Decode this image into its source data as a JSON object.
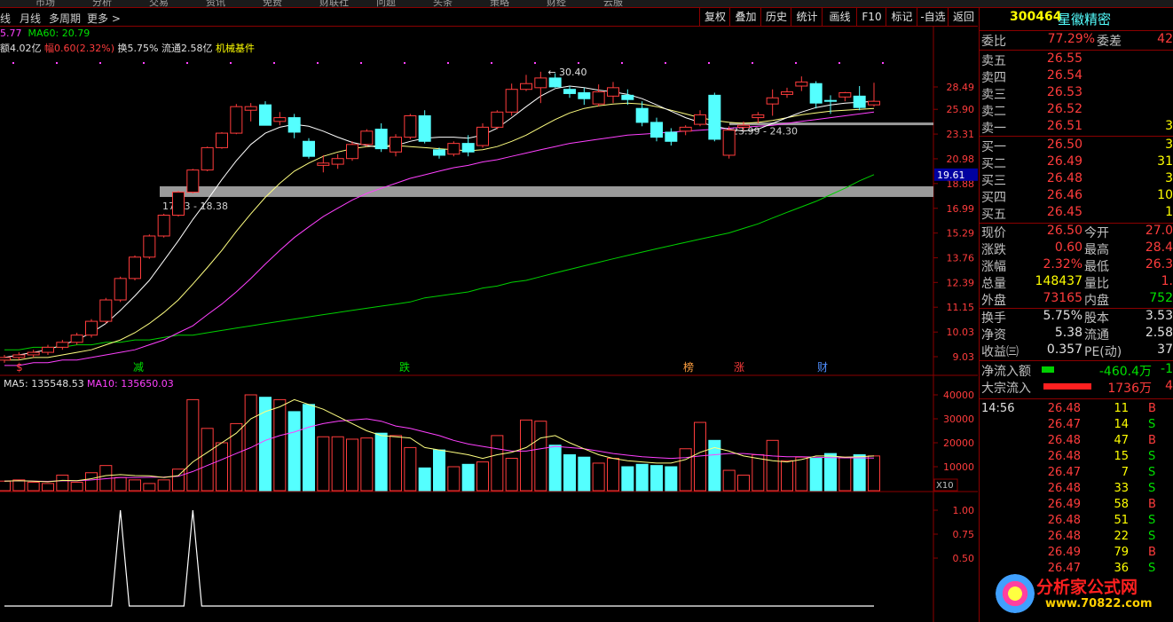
{
  "top_menu": [
    "市场",
    "分析",
    "交易",
    "资讯",
    "免费",
    "财联社",
    "问题",
    "头条",
    "策略",
    "财经",
    "云服"
  ],
  "menubar": {
    "left_items": [
      "线",
      "月线",
      "多周期",
      "更多 >"
    ],
    "buttons": [
      "复权",
      "叠加",
      "历史",
      "统计",
      "画线",
      "F10",
      "标记",
      "-自选",
      "返回"
    ]
  },
  "info_line1": {
    "ma_a": "5.77",
    "ma60_label": "MA60: 20.79"
  },
  "info_line2": {
    "amount": "额4.02亿",
    "change": "幅0.60(2.32%)",
    "turnover": "换5.75%",
    "float": "流通2.58亿",
    "sector": "机械基件"
  },
  "main_chart": {
    "price_axis": [
      "28.49",
      "25.90",
      "23.31",
      "20.98",
      "18.88",
      "16.99",
      "15.29",
      "13.76",
      "12.39",
      "11.15",
      "10.03",
      "9.03"
    ],
    "current_price_tag": "19.61",
    "annotations": {
      "high": "30.40",
      "zone_upper": "23.99 - 24.30",
      "zone_lower": "17.53 - 18.38"
    },
    "events": [
      {
        "label": "$",
        "color": "#ff3c3c"
      },
      {
        "label": "减",
        "color": "#00e000"
      },
      {
        "label": "跌",
        "color": "#00e000"
      },
      {
        "label": "榜",
        "color": "#ffa040"
      },
      {
        "label": "涨",
        "color": "#ff3c3c"
      },
      {
        "label": "财",
        "color": "#4f8fff"
      }
    ]
  },
  "volume_chart": {
    "ma5_label": "MA5: 135548.53",
    "ma10_label": "MA10: 135650.03",
    "axis": [
      "40000",
      "30000",
      "20000",
      "10000"
    ],
    "unit": "X10"
  },
  "indicator_chart": {
    "axis": [
      "1.00",
      "0.75",
      "0.50"
    ]
  },
  "chart_data": [
    {
      "type": "candlestick",
      "candles": [
        [
          8.9,
          9.1,
          8.8,
          9.0
        ],
        [
          9.0,
          9.2,
          8.9,
          9.1
        ],
        [
          9.1,
          9.3,
          9.0,
          9.2
        ],
        [
          9.2,
          9.5,
          9.1,
          9.4
        ],
        [
          9.4,
          9.7,
          9.3,
          9.6
        ],
        [
          9.6,
          10.0,
          9.5,
          9.9
        ],
        [
          9.9,
          10.6,
          9.8,
          10.5
        ],
        [
          10.5,
          11.6,
          10.4,
          11.5
        ],
        [
          11.5,
          12.7,
          11.4,
          12.6
        ],
        [
          12.6,
          13.9,
          12.5,
          13.8
        ],
        [
          13.8,
          15.2,
          13.7,
          15.1
        ],
        [
          15.1,
          16.6,
          15.0,
          16.5
        ],
        [
          16.5,
          18.3,
          16.4,
          18.2
        ],
        [
          18.2,
          20.1,
          18.1,
          20.0
        ],
        [
          20.0,
          22.1,
          19.9,
          22.0
        ],
        [
          22.0,
          23.5,
          21.9,
          23.4
        ],
        [
          23.4,
          26.5,
          23.3,
          26.2
        ],
        [
          25.8,
          26.6,
          24.6,
          26.2
        ],
        [
          26.4,
          26.8,
          25.1,
          24.2
        ],
        [
          24.6,
          25.6,
          24.2,
          25.0
        ],
        [
          25.0,
          25.4,
          22.9,
          23.5
        ],
        [
          22.6,
          22.9,
          21.0,
          21.2
        ],
        [
          20.4,
          21.3,
          19.8,
          20.6
        ],
        [
          20.5,
          21.4,
          20.1,
          21.0
        ],
        [
          21.0,
          22.6,
          20.8,
          22.3
        ],
        [
          22.3,
          23.8,
          22.1,
          23.6
        ],
        [
          23.8,
          24.4,
          21.6,
          21.9
        ],
        [
          21.6,
          23.3,
          21.2,
          23.0
        ],
        [
          23.0,
          25.4,
          22.8,
          25.2
        ],
        [
          25.2,
          25.8,
          22.4,
          22.6
        ],
        [
          21.8,
          22.0,
          21.0,
          21.3
        ],
        [
          21.4,
          22.6,
          21.2,
          22.4
        ],
        [
          22.4,
          23.2,
          21.2,
          21.6
        ],
        [
          22.2,
          24.4,
          22.0,
          24.0
        ],
        [
          24.0,
          25.8,
          23.8,
          25.6
        ],
        [
          25.6,
          28.9,
          25.2,
          28.2
        ],
        [
          28.2,
          30.0,
          28.0,
          28.9
        ],
        [
          28.4,
          30.4,
          26.6,
          29.6
        ],
        [
          29.6,
          30.2,
          28.4,
          28.5
        ],
        [
          28.2,
          28.6,
          27.2,
          27.7
        ],
        [
          27.8,
          28.4,
          26.4,
          27.1
        ],
        [
          26.5,
          28.8,
          26.2,
          27.9
        ],
        [
          27.4,
          29.1,
          26.6,
          28.4
        ],
        [
          27.5,
          28.2,
          26.4,
          27.0
        ],
        [
          26.0,
          26.8,
          24.1,
          24.5
        ],
        [
          24.5,
          25.0,
          22.6,
          23.0
        ],
        [
          23.5,
          23.9,
          22.2,
          22.6
        ],
        [
          23.6,
          24.2,
          23.2,
          24.0
        ],
        [
          24.3,
          25.8,
          24.1,
          25.3
        ],
        [
          27.5,
          27.8,
          22.6,
          22.8
        ],
        [
          21.3,
          24.1,
          21.0,
          23.7
        ],
        [
          24.0,
          24.6,
          23.7,
          24.2
        ],
        [
          25.0,
          25.6,
          24.4,
          25.3
        ],
        [
          26.5,
          28.2,
          25.2,
          27.2
        ],
        [
          27.6,
          28.4,
          27.2,
          27.9
        ],
        [
          28.6,
          29.8,
          28.0,
          29.1
        ],
        [
          28.9,
          29.2,
          26.0,
          26.6
        ],
        [
          26.9,
          27.5,
          25.4,
          26.8
        ],
        [
          27.3,
          27.9,
          26.8,
          27.8
        ],
        [
          27.4,
          28.6,
          25.8,
          26.1
        ],
        [
          26.4,
          29.0,
          26.2,
          26.8
        ]
      ],
      "ma_short": [
        9.0,
        9.1,
        9.2,
        9.3,
        9.5,
        9.7,
        10.0,
        10.4,
        11.0,
        11.7,
        12.5,
        13.6,
        14.8,
        16.2,
        17.6,
        19.2,
        20.8,
        22.3,
        23.4,
        24.0,
        24.3,
        24.1,
        23.6,
        23.0,
        22.5,
        22.2,
        22.0,
        22.2,
        22.6,
        22.9,
        23.0,
        23.0,
        22.9,
        23.2,
        23.9,
        25.0,
        26.2,
        27.4,
        28.3,
        28.6,
        28.4,
        28.1,
        27.9,
        27.6,
        27.1,
        26.4,
        25.7,
        25.0,
        24.5,
        24.1,
        23.8,
        23.6,
        23.8,
        24.4,
        25.0,
        25.6,
        26.1,
        26.4,
        26.6,
        26.7,
        26.8
      ],
      "ma_mid": [
        8.9,
        8.9,
        9.0,
        9.0,
        9.1,
        9.2,
        9.3,
        9.5,
        9.7,
        10.0,
        10.4,
        10.9,
        11.5,
        12.3,
        13.2,
        14.2,
        15.4,
        16.6,
        17.8,
        18.9,
        19.9,
        20.6,
        21.2,
        21.6,
        21.9,
        22.1,
        22.2,
        22.2,
        22.1,
        22.0,
        21.9,
        21.8,
        21.7,
        21.8,
        22.1,
        22.6,
        23.2,
        24.0,
        24.8,
        25.5,
        26.0,
        26.3,
        26.5,
        26.6,
        26.5,
        26.2,
        25.8,
        25.4,
        25.0,
        24.7,
        24.5,
        24.4,
        24.5,
        24.7,
        25.0,
        25.3,
        25.5,
        25.7,
        25.8,
        25.9,
        26.0
      ],
      "ma_long": [
        8.7,
        8.7,
        8.8,
        8.8,
        8.9,
        8.9,
        9.0,
        9.1,
        9.2,
        9.3,
        9.5,
        9.7,
        10.0,
        10.3,
        10.8,
        11.3,
        11.9,
        12.6,
        13.4,
        14.2,
        15.0,
        15.7,
        16.4,
        17.0,
        17.6,
        18.1,
        18.5,
        18.9,
        19.3,
        19.6,
        19.9,
        20.2,
        20.4,
        20.7,
        20.9,
        21.2,
        21.5,
        21.8,
        22.1,
        22.4,
        22.6,
        22.8,
        23.0,
        23.2,
        23.3,
        23.4,
        23.5,
        23.6,
        23.7,
        23.8,
        23.9,
        24.0,
        24.1,
        24.2,
        24.4,
        24.6,
        24.8,
        25.0,
        25.2,
        25.4,
        25.6
      ],
      "ma60": [
        9.3,
        9.3,
        9.4,
        9.4,
        9.4,
        9.5,
        9.5,
        9.6,
        9.6,
        9.7,
        9.7,
        9.8,
        9.9,
        9.9,
        10.0,
        10.1,
        10.2,
        10.3,
        10.4,
        10.5,
        10.6,
        10.7,
        10.8,
        10.9,
        11.0,
        11.1,
        11.2,
        11.3,
        11.4,
        11.6,
        11.7,
        11.8,
        11.9,
        12.1,
        12.2,
        12.4,
        12.5,
        12.7,
        12.9,
        13.1,
        13.3,
        13.5,
        13.7,
        13.9,
        14.1,
        14.3,
        14.5,
        14.7,
        14.9,
        15.1,
        15.3,
        15.6,
        15.9,
        16.3,
        16.7,
        17.1,
        17.5,
        18.0,
        18.5,
        19.1,
        19.61
      ]
    },
    {
      "type": "bar",
      "title": "",
      "series": [
        {
          "name": "VOL",
          "values": [
            4000,
            4500,
            3500,
            3000,
            6500,
            3500,
            7500,
            10500,
            5500,
            4500,
            3000,
            4500,
            9000,
            38000,
            26000,
            20000,
            28000,
            40000,
            39000,
            38000,
            33000,
            36000,
            22500,
            22500,
            21500,
            22000,
            24000,
            23000,
            18000,
            9500,
            17000,
            10000,
            11000,
            12000,
            23000,
            13500,
            29500,
            29000,
            19000,
            15000,
            14000,
            11500,
            13500,
            10000,
            11000,
            10500,
            10000,
            17500,
            28500,
            21000,
            8500,
            6500,
            15000,
            21000,
            12500,
            14000,
            13500,
            15500,
            14000,
            15000,
            14500
          ]
        },
        {
          "name": "MA5",
          "values": [
            4000,
            4200,
            4000,
            3700,
            4300,
            4200,
            5000,
            6300,
            6700,
            6300,
            6200,
            5500,
            6300,
            12000,
            16000,
            20000,
            24000,
            30000,
            33000,
            35000,
            38000,
            36000,
            34000,
            31000,
            28000,
            25000,
            23000,
            22500,
            22000,
            18000,
            17000,
            16000,
            15000,
            13500,
            15000,
            16000,
            18000,
            22000,
            23000,
            20000,
            17500,
            15000,
            13500,
            12500,
            12000,
            11500,
            11500,
            13000,
            16000,
            18000,
            16500,
            14500,
            13500,
            12500,
            12000,
            13000,
            14500,
            14500,
            14000,
            14200,
            14500
          ]
        },
        {
          "name": "MA10",
          "values": [
            4000,
            4100,
            4000,
            3900,
            4100,
            4100,
            4500,
            5000,
            5500,
            5500,
            5600,
            5700,
            6000,
            8000,
            10500,
            13000,
            15500,
            18000,
            21000,
            23000,
            24500,
            26500,
            28000,
            29000,
            29500,
            30000,
            29000,
            27000,
            26000,
            24500,
            23000,
            21000,
            19500,
            18500,
            17500,
            16500,
            16500,
            17500,
            18500,
            18000,
            17500,
            16500,
            15500,
            14800,
            14200,
            13800,
            13500,
            13800,
            14500,
            15000,
            15500,
            15500,
            15000,
            14500,
            14200,
            14200,
            14000,
            13800,
            13700,
            13700,
            13600
          ]
        }
      ]
    },
    {
      "type": "line",
      "series": [
        {
          "name": "",
          "values": [
            0,
            0,
            0,
            0,
            0,
            0,
            0,
            0,
            0,
            0,
            0,
            0,
            0,
            0,
            0,
            0,
            0,
            0,
            0,
            0,
            0,
            0,
            0,
            0,
            0,
            0,
            0,
            0,
            0,
            0,
            0,
            0,
            0,
            0,
            0,
            0,
            0,
            0,
            0,
            0,
            0,
            0,
            0,
            0,
            0,
            0,
            0,
            0,
            0,
            0,
            0,
            0,
            0,
            0,
            0,
            0,
            0,
            0,
            0,
            0,
            0
          ]
        },
        {
          "name": "spikes",
          "values": [
            [
              8,
              1.0
            ],
            [
              13,
              1.0
            ]
          ]
        }
      ]
    }
  ],
  "quote_panel": {
    "code": "300464",
    "name": "星徽精密",
    "webi": {
      "label": "委比",
      "value": "77.29%",
      "label2": "委差",
      "value2": "42"
    },
    "asks": [
      {
        "label": "卖五",
        "price": "26.55",
        "vol": ""
      },
      {
        "label": "卖四",
        "price": "26.54",
        "vol": ""
      },
      {
        "label": "卖三",
        "price": "26.53",
        "vol": ""
      },
      {
        "label": "卖二",
        "price": "26.52",
        "vol": ""
      },
      {
        "label": "卖一",
        "price": "26.51",
        "vol": "3"
      }
    ],
    "bids": [
      {
        "label": "买一",
        "price": "26.50",
        "vol": "3"
      },
      {
        "label": "买二",
        "price": "26.49",
        "vol": "31"
      },
      {
        "label": "买三",
        "price": "26.48",
        "vol": "3"
      },
      {
        "label": "买四",
        "price": "26.46",
        "vol": "10"
      },
      {
        "label": "买五",
        "price": "26.45",
        "vol": "1"
      }
    ],
    "stats": [
      {
        "l1": "现价",
        "v1": "26.50",
        "c1": "red",
        "l2": "今开",
        "v2": "27.0",
        "c2": "red"
      },
      {
        "l1": "涨跌",
        "v1": "0.60",
        "c1": "red",
        "l2": "最高",
        "v2": "28.4",
        "c2": "red"
      },
      {
        "l1": "涨幅",
        "v1": "2.32%",
        "c1": "red",
        "l2": "最低",
        "v2": "26.3",
        "c2": "red"
      },
      {
        "l1": "总量",
        "v1": "148437",
        "c1": "yellow",
        "l2": "量比",
        "v2": "1.",
        "c2": "red"
      },
      {
        "l1": "外盘",
        "v1": "73165",
        "c1": "red",
        "l2": "内盘",
        "v2": "752",
        "c2": "green"
      }
    ],
    "stats2": [
      {
        "l1": "换手",
        "v1": "5.75%",
        "l2": "股本",
        "v2": "3.53"
      },
      {
        "l1": "净资",
        "v1": "5.38",
        "l2": "流通",
        "v2": "2.58"
      },
      {
        "l1": "收益㈢",
        "v1": "0.357",
        "l2": "PE(动)",
        "v2": "37"
      }
    ],
    "flows": [
      {
        "label": "净流入额",
        "value": "-460.4万",
        "extra": "-1",
        "bar": "green"
      },
      {
        "label": "大宗流入",
        "value": "1736万",
        "extra": "4",
        "bar": "red"
      }
    ],
    "ticks": [
      {
        "time": "14:56",
        "price": "26.48",
        "vol": "11",
        "side": "B"
      },
      {
        "time": "",
        "price": "26.47",
        "vol": "14",
        "side": "S"
      },
      {
        "time": "",
        "price": "26.48",
        "vol": "47",
        "side": "B"
      },
      {
        "time": "",
        "price": "26.48",
        "vol": "15",
        "side": "S"
      },
      {
        "time": "",
        "price": "26.47",
        "vol": "7",
        "side": "S"
      },
      {
        "time": "",
        "price": "26.48",
        "vol": "33",
        "side": "S"
      },
      {
        "time": "",
        "price": "26.49",
        "vol": "58",
        "side": "B"
      },
      {
        "time": "",
        "price": "26.48",
        "vol": "51",
        "side": "S"
      },
      {
        "time": "",
        "price": "26.48",
        "vol": "22",
        "side": "S"
      },
      {
        "time": "",
        "price": "26.49",
        "vol": "79",
        "side": "B"
      },
      {
        "time": "",
        "price": "26.47",
        "vol": "36",
        "side": "S"
      }
    ]
  },
  "watermark": {
    "line1": "分析家公式网",
    "line2": "www.70822.com"
  }
}
